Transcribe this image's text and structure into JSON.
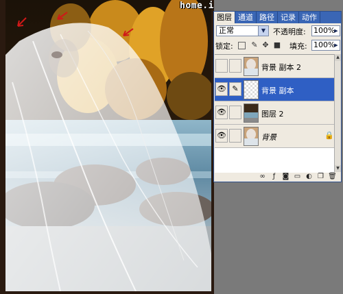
{
  "watermark": "home.iecool.com",
  "panel": {
    "tabs": [
      {
        "label": "图层"
      },
      {
        "label": "通道"
      },
      {
        "label": "路径"
      },
      {
        "label": "记录"
      },
      {
        "label": "动作"
      }
    ],
    "blend_mode": "正常",
    "opacity_label": "不透明度:",
    "opacity_value": "100%",
    "lock_label": "锁定:",
    "fill_label": "填充:",
    "fill_value": "100%",
    "layers": [
      {
        "name": "背景 副本 2",
        "visible": false,
        "selected": false
      },
      {
        "name": "背景 副本",
        "visible": true,
        "selected": true
      },
      {
        "name": "图层 2",
        "visible": true,
        "selected": false
      },
      {
        "name": "背景",
        "visible": true,
        "selected": false,
        "locked": true
      }
    ],
    "bottom_icons": [
      "link-layers-icon",
      "layer-style-icon",
      "layer-mask-icon",
      "new-set-icon",
      "adjustment-layer-icon",
      "new-layer-icon",
      "trash-icon"
    ]
  },
  "colors": {
    "tab_bar": "#3a66b5",
    "selected_layer": "#2f5fc4",
    "panel_bg": "#efeae0"
  }
}
